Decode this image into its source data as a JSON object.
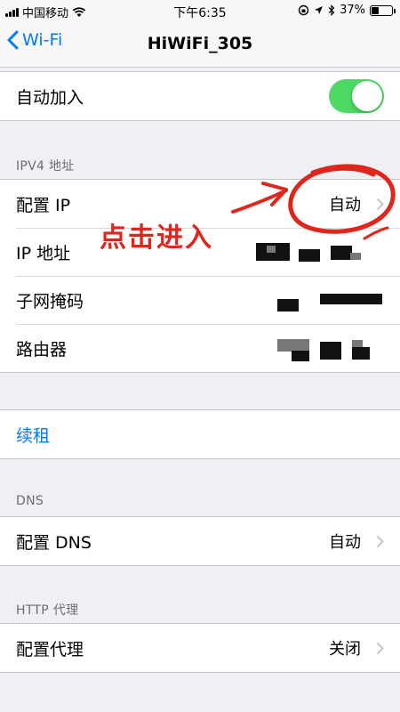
{
  "status_bar": {
    "carrier": "中国移动",
    "time": "下午6:35",
    "battery_percent": "37%",
    "battery_level": 0.37
  },
  "nav": {
    "back_label": "Wi-Fi",
    "title": "HiWiFi_305"
  },
  "auto_join": {
    "label": "自动加入",
    "enabled": true
  },
  "ipv4": {
    "header": "IPV4 地址",
    "configure_ip": {
      "label": "配置 IP",
      "value": "自动"
    },
    "ip_address": {
      "label": "IP 地址"
    },
    "subnet_mask": {
      "label": "子网掩码"
    },
    "router": {
      "label": "路由器"
    }
  },
  "renew_lease": {
    "label": "续租"
  },
  "dns": {
    "header": "DNS",
    "configure_dns": {
      "label": "配置 DNS",
      "value": "自动"
    }
  },
  "http_proxy": {
    "header": "HTTP 代理",
    "configure_proxy": {
      "label": "配置代理",
      "value": "关闭"
    }
  },
  "annotation": {
    "text": "点击进入",
    "color": "#e0261c"
  },
  "colors": {
    "accent": "#007aff",
    "toggle_on": "#4cd964",
    "background": "#efeff4"
  }
}
